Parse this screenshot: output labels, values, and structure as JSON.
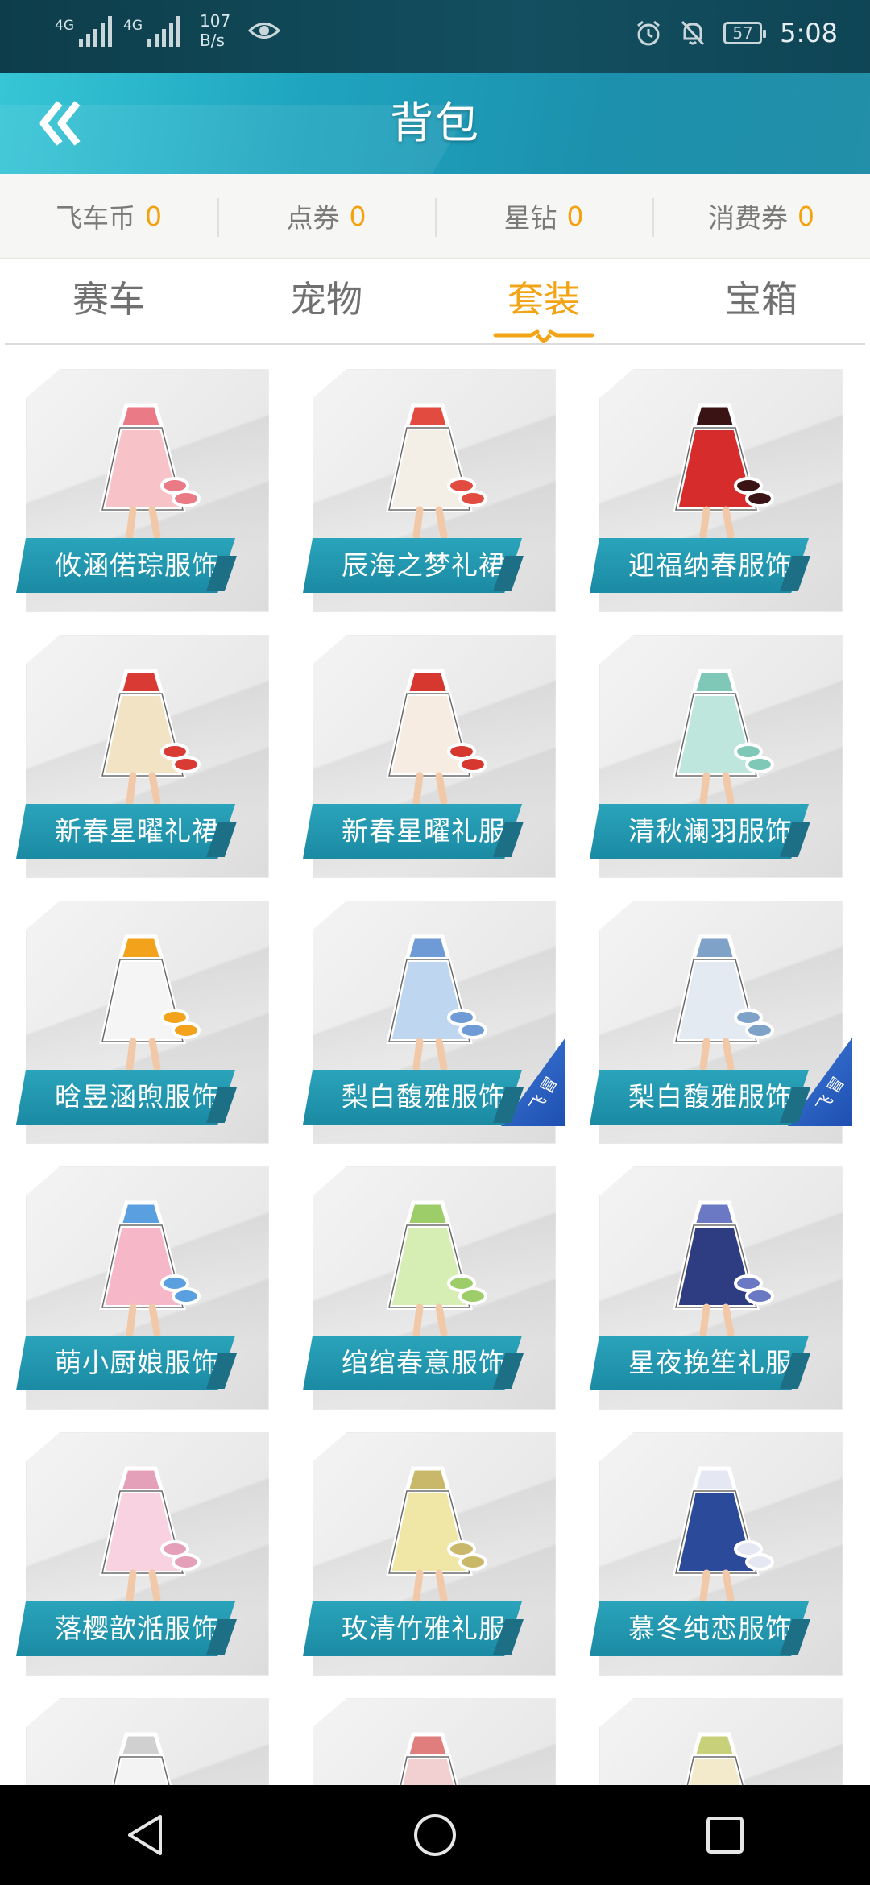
{
  "status_bar": {
    "net1": "4G",
    "net2": "4G",
    "speed_value": "107",
    "speed_unit": "B/s",
    "battery": "57",
    "time": "5:08"
  },
  "header": {
    "title": "背包"
  },
  "currency": [
    {
      "label": "飞车币",
      "value": "0"
    },
    {
      "label": "点券",
      "value": "0"
    },
    {
      "label": "星钻",
      "value": "0"
    },
    {
      "label": "消费券",
      "value": "0"
    }
  ],
  "tabs": [
    {
      "label": "赛车"
    },
    {
      "label": "宠物"
    },
    {
      "label": "套装"
    },
    {
      "label": "宝箱"
    }
  ],
  "active_tab": "套装",
  "items": [
    {
      "name": "攸涵偌琮服饰",
      "main": "#f7c3c8",
      "accent": "#e97a86"
    },
    {
      "name": "辰海之梦礼裙",
      "main": "#f4efe6",
      "accent": "#e24b40"
    },
    {
      "name": "迎福纳春服饰",
      "main": "#d62c2c",
      "accent": "#3a1414"
    },
    {
      "name": "新春星曜礼裙",
      "main": "#f2e3c4",
      "accent": "#d93a34"
    },
    {
      "name": "新春星曜礼服",
      "main": "#f6ece2",
      "accent": "#d6382f"
    },
    {
      "name": "清秋澜羽服饰",
      "main": "#bfe6dc",
      "accent": "#7fc7b6"
    },
    {
      "name": "晗昱涵煦服饰",
      "main": "#f5f5f5",
      "accent": "#f3a21c"
    },
    {
      "name": "梨白馥雅服饰",
      "main": "#bfd6f0",
      "accent": "#6e9bd5",
      "badge": "飞 冒"
    },
    {
      "name": "梨白馥雅服饰",
      "main": "#e4eaf1",
      "accent": "#7fa2c8",
      "badge": "飞 冒"
    },
    {
      "name": "萌小厨娘服饰",
      "main": "#f6b7c8",
      "accent": "#5aa0e0"
    },
    {
      "name": "绾绾春意服饰",
      "main": "#d6edb4",
      "accent": "#9ccd69"
    },
    {
      "name": "星夜挽笙礼服",
      "main": "#2e3c82",
      "accent": "#6b79c4"
    },
    {
      "name": "落樱歆湉服饰",
      "main": "#f8d2e0",
      "accent": "#e4a0b8"
    },
    {
      "name": "玫清竹雅礼服",
      "main": "#f0e7a6",
      "accent": "#c9b86a"
    },
    {
      "name": "慕冬纯恋服饰",
      "main": "#2c4a9a",
      "accent": "#e5e8f2"
    },
    {
      "name": "",
      "main": "#f3f3f3",
      "accent": "#d0d0d0"
    },
    {
      "name": "",
      "main": "#f2cfd0",
      "accent": "#e07e7e"
    },
    {
      "name": "",
      "main": "#f2eacb",
      "accent": "#c8d07a"
    }
  ],
  "nav": [
    {
      "icon": "back-triangle-icon"
    },
    {
      "icon": "home-circle-icon"
    },
    {
      "icon": "recents-square-icon"
    }
  ]
}
